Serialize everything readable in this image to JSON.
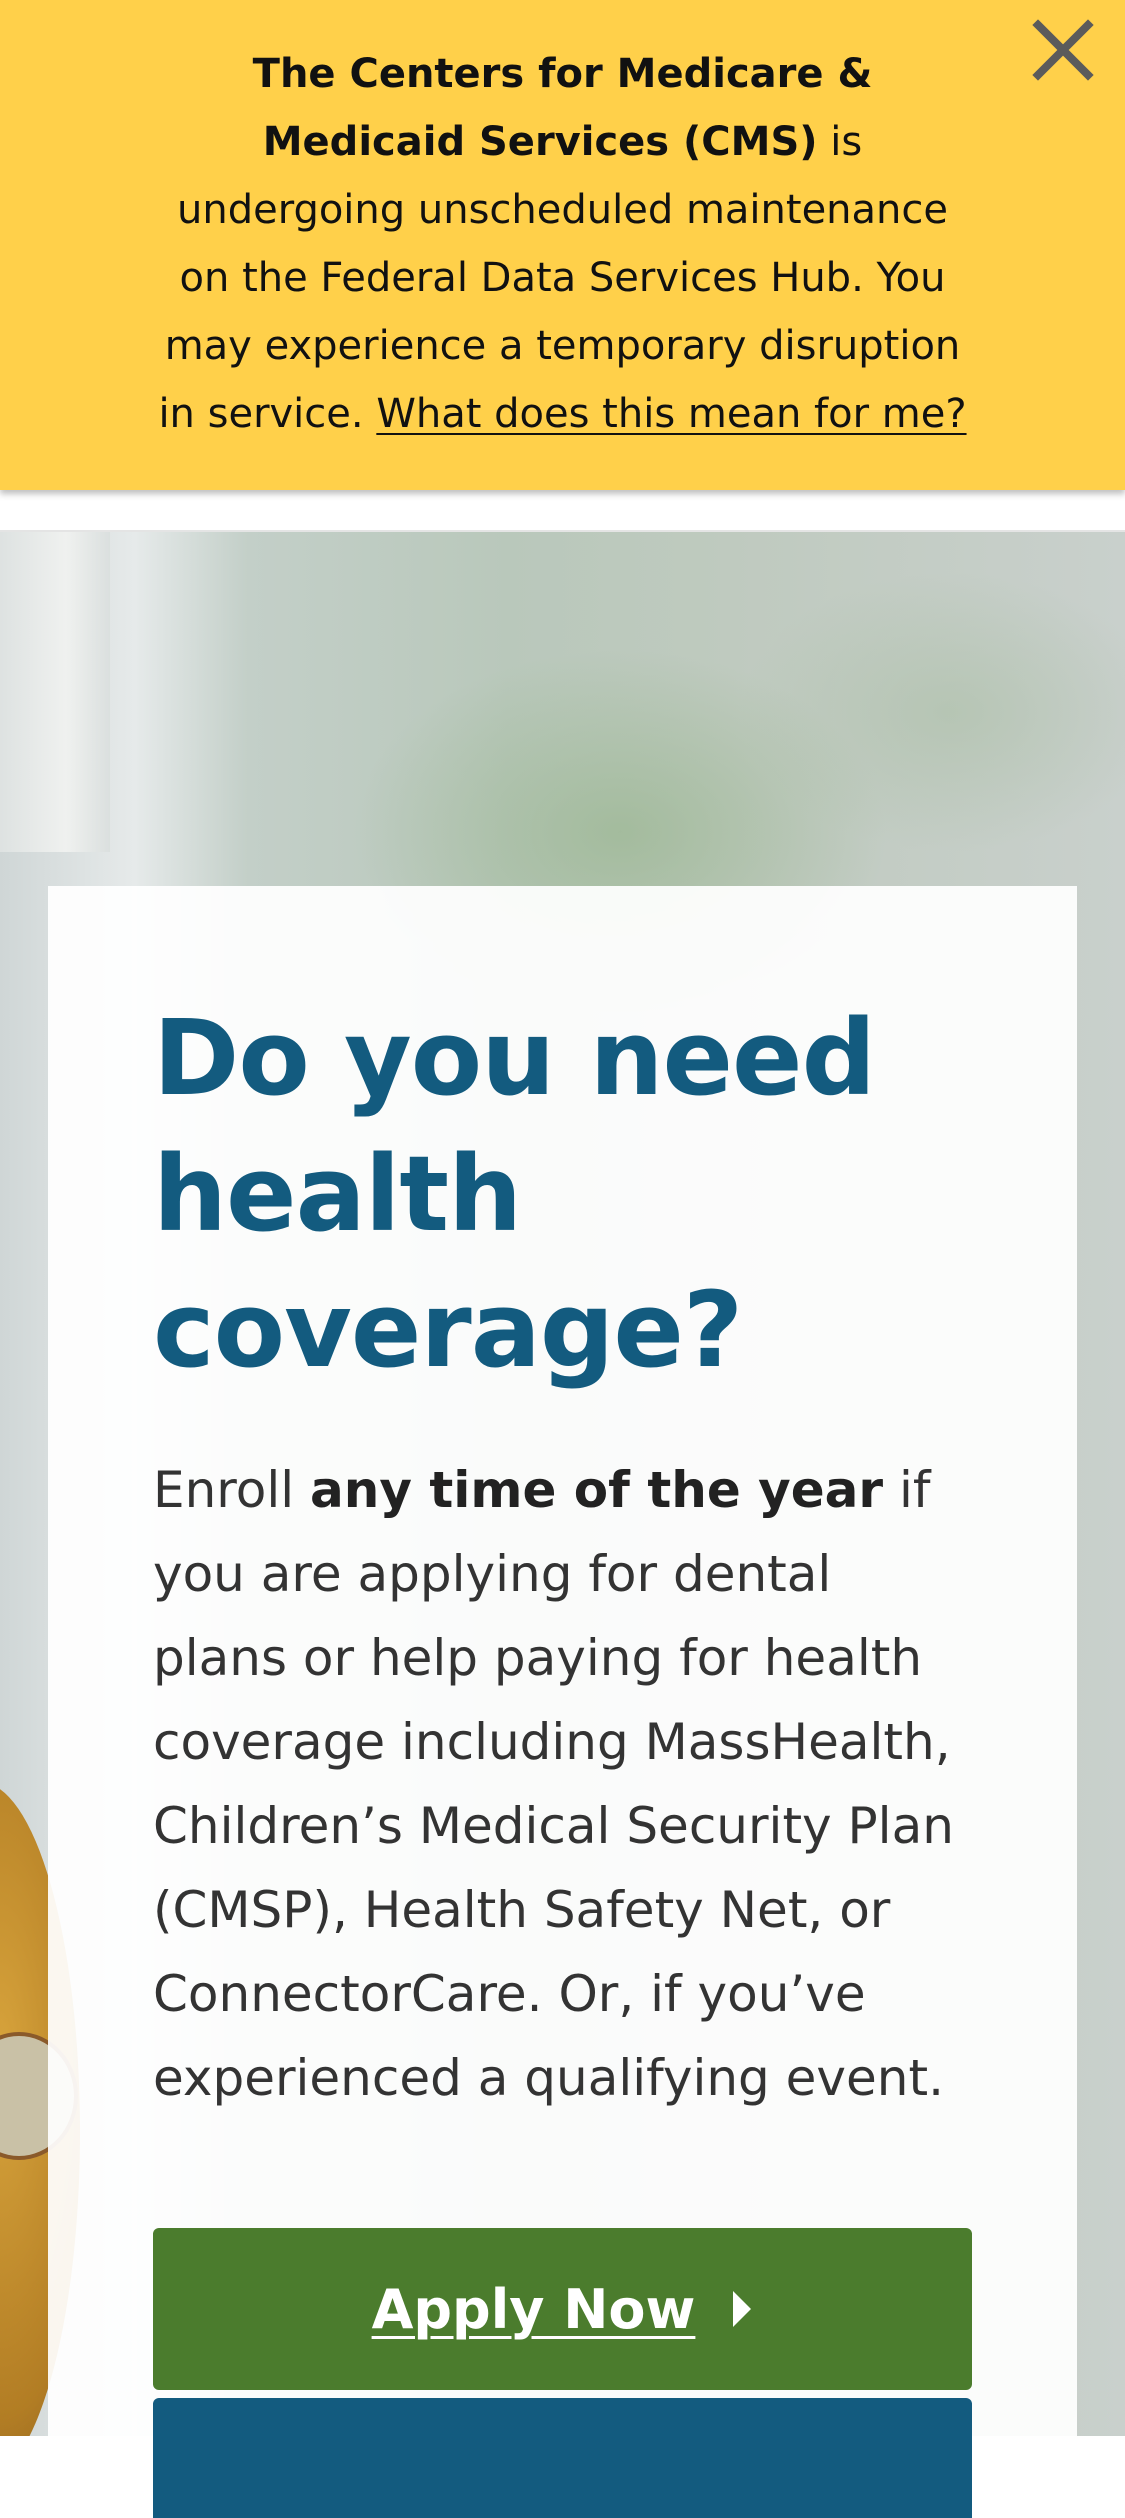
{
  "alert": {
    "text_bold": "The Centers for Medicare & Medicaid Services (CMS)",
    "text_rest": " is undergoing unscheduled maintenance on the Federal Data Services Hub. You may experience a temporary disruption in service. ",
    "link_text": "What does this mean for me?",
    "close_icon": "close-x-icon",
    "background_color": "#ffd04a"
  },
  "hero": {
    "title": "Do you need health coverage?",
    "body_prefix": "Enroll ",
    "body_bold": "any time of the year",
    "body_rest": " if you are applying for dental plans or help paying for health coverage including MassHealth, Children’s Medical Security Plan (CMSP), Health Safety Net, or ConnectorCare. Or, if you’ve experienced a qualifying event.",
    "apply_button_label": "Apply Now",
    "apply_icon": "caret-right-icon",
    "title_color": "#135b7f",
    "apply_button_color": "#4b7c2d",
    "secondary_button_color": "#135b7f"
  }
}
